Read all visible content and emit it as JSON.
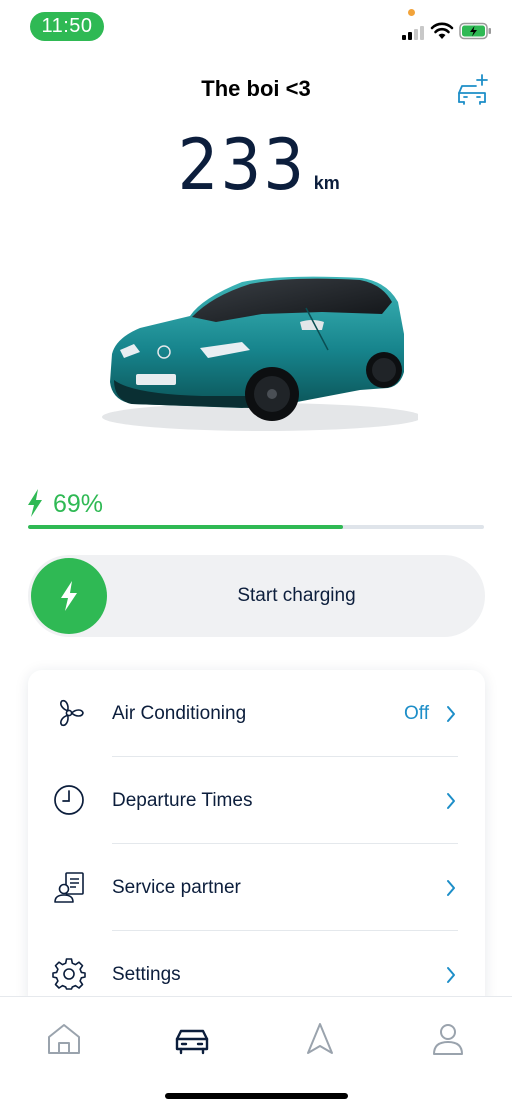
{
  "status_bar": {
    "time": "11:50",
    "accent_color": "#2fb954"
  },
  "header": {
    "car_name": "The boi <3",
    "range_value": "233",
    "range_unit": "km"
  },
  "battery": {
    "percent_label": "69%",
    "level_fraction": 0.69,
    "color": "#2fb954"
  },
  "charging": {
    "button_label": "Start charging",
    "knob_icon": "bolt-icon"
  },
  "menu": {
    "items": [
      {
        "label": "Air Conditioning",
        "value": "Off",
        "icon": "fan-icon"
      },
      {
        "label": "Departure Times",
        "value": "",
        "icon": "clock-icon"
      },
      {
        "label": "Service partner",
        "value": "",
        "icon": "service-partner-icon"
      },
      {
        "label": "Settings",
        "value": "",
        "icon": "gear-icon"
      }
    ],
    "link_color": "#1d8ec8"
  },
  "tab_bar": {
    "tabs": [
      {
        "icon": "home-icon",
        "active": false
      },
      {
        "icon": "car-icon",
        "active": true
      },
      {
        "icon": "navigation-icon",
        "active": false
      },
      {
        "icon": "profile-icon",
        "active": false
      }
    ]
  }
}
